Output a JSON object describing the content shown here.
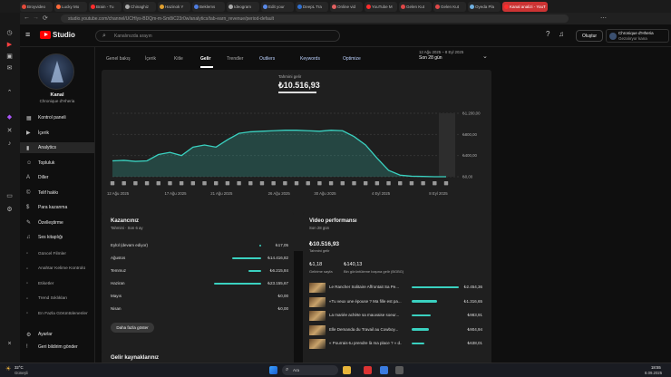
{
  "browser_tabs": [
    {
      "label": "Broyvideo",
      "color": "#e34a3a"
    },
    {
      "label": "Lucky Mo",
      "color": "#ff6a3a"
    },
    {
      "label": "Brain - Tu",
      "color": "#ff2d2d"
    },
    {
      "label": "Chinaghiz",
      "color": "#aaaaaa"
    },
    {
      "label": "Hazinok Y",
      "color": "#e0a030"
    },
    {
      "label": "Beklems",
      "color": "#4f7de0"
    },
    {
      "label": "Ideogram",
      "color": "#aaaaaa"
    },
    {
      "label": "Edit your",
      "color": "#5a8ae8"
    },
    {
      "label": "DeepL Tra",
      "color": "#3070d0"
    },
    {
      "label": "Online vid",
      "color": "#e06060"
    },
    {
      "label": "YouTube M",
      "color": "#ff2d2d"
    },
    {
      "label": "Gelen Kut",
      "color": "#e04848"
    },
    {
      "label": "Gelen Kut",
      "color": "#e04848"
    },
    {
      "label": "Oyeda Pla",
      "color": "#70b0e0"
    },
    {
      "label": "Kanal analizi - YouT",
      "color": "#ff2d2d"
    }
  ],
  "url": "studio.youtube.com/channel/UCHlys-BDQm-m-Sm8iC23r0w/analytics/tab-earn_revenue/period-default",
  "header": {
    "logo_text": "Studio",
    "search_placeholder": "Kanalınızda arayın",
    "create_label": "Oluştur",
    "channel_name": "Chronique d'Hheria",
    "channel_sub": "Gezalıryor kana"
  },
  "sidebar": {
    "channel_title": "Kanal",
    "channel_handle": "Chronique d'Hheria",
    "items": [
      {
        "label": "Kontrol paneli",
        "icon": "▦"
      },
      {
        "label": "İçerik",
        "icon": "▶"
      },
      {
        "label": "Analytics",
        "icon": "▮"
      },
      {
        "label": "Topluluk",
        "icon": "☺"
      },
      {
        "label": "Diller",
        "icon": "A"
      },
      {
        "label": "Telif hakkı",
        "icon": "©"
      },
      {
        "label": "Para kazanma",
        "icon": "$"
      },
      {
        "label": "Özelleştirme",
        "icon": "✎"
      },
      {
        "label": "Ses kitaplığı",
        "icon": "♫"
      }
    ],
    "sub_items": [
      {
        "label": "Güncel Filmler",
        "icon": "◦"
      },
      {
        "label": "Anahtar Kelime Kontrolü",
        "icon": "◦"
      },
      {
        "label": "Etiketler",
        "icon": "◦"
      },
      {
        "label": "Trend Sıklıkları",
        "icon": "◦"
      },
      {
        "label": "En Fazla Görüntülenenler",
        "icon": "◦"
      }
    ],
    "footer": [
      {
        "label": "Ayarlar",
        "icon": "⚙"
      },
      {
        "label": "Geri bildirim gönder",
        "icon": "!"
      }
    ]
  },
  "analytics_tabs": [
    {
      "label": "Genel bakış",
      "active": false
    },
    {
      "label": "İçerik",
      "active": false
    },
    {
      "label": "Kitle",
      "active": false
    },
    {
      "label": "Gelir",
      "active": true
    },
    {
      "label": "Trendler",
      "active": false
    },
    {
      "label": "Outliers",
      "active": false
    },
    {
      "label": "Keywords",
      "active": false
    },
    {
      "label": "Optimize",
      "active": false
    }
  ],
  "period": {
    "range": "12 Ağu 2025 – 8 Eyl 2025",
    "label": "Son 28 gün"
  },
  "revenue_chart": {
    "metric_label": "Tahmini gelir",
    "metric_value": "₺10.516,93",
    "more_button": "Daha fazla göster"
  },
  "chart_data": {
    "type": "area",
    "x_ticks": [
      "12 Ağu 2025",
      "17 Ağu 2025",
      "21 Ağu 2025",
      "26 Ağu 2025",
      "30 Ağu 2025",
      "4 Eyl 2025",
      "8 Eyl 2025"
    ],
    "y_ticks": [
      "₺1.200,00",
      "₺800,00",
      "₺400,00",
      "₺0,00"
    ],
    "ylim": [
      0,
      1200
    ],
    "values": [
      300,
      310,
      290,
      300,
      420,
      460,
      400,
      560,
      600,
      560,
      700,
      820,
      850,
      860,
      870,
      880,
      880,
      870,
      860,
      880,
      870,
      760,
      600,
      350,
      120,
      30,
      10,
      5,
      0,
      0
    ],
    "color": "#3ad1c0"
  },
  "earnings": {
    "title": "Kazancınız",
    "subtitle": "Tahmini · Son 6 ay",
    "rows": [
      {
        "month": "Eylül (devam ediyor)",
        "value": "₺17,05",
        "fraction": 0.02
      },
      {
        "month": "Ağustos",
        "value": "₺14.416,82",
        "fraction": 0.62
      },
      {
        "month": "Temmuz",
        "value": "₺6.215,84",
        "fraction": 0.27
      },
      {
        "month": "Haziran",
        "value": "₺23.155,67",
        "fraction": 1.0
      },
      {
        "month": "Mayıs",
        "value": "₺0,00",
        "fraction": 0
      },
      {
        "month": "Nisan",
        "value": "₺0,00",
        "fraction": 0
      }
    ],
    "more_button": "Daha fazla göster"
  },
  "video_performance": {
    "title": "Video performansı",
    "subtitle": "Son 28 gün",
    "total_value": "₺10.516,93",
    "total_label": "Tahmini gelir",
    "rpm_value": "₺1,18",
    "rpm_label": "Gelirime sayfa",
    "cpm_value": "₺140,13",
    "cpm_label": "Bin görüntüleme başına gelir (BGBG)",
    "videos": [
      {
        "title": "Le Rancher Solitaire Affrontait Sa Pe...",
        "value": "₺2.454,36",
        "fraction": 1.0
      },
      {
        "title": "«Tu veux une épouse ? Ma fille est pa...",
        "value": "₺1.316,65",
        "fraction": 0.54
      },
      {
        "title": "La mariée achète sa mauvaise soeur...",
        "value": "₺983,91",
        "fraction": 0.4
      },
      {
        "title": "Elle Demanda du Travail au Cowboy...",
        "value": "₺904,94",
        "fraction": 0.37
      },
      {
        "title": "« Pourrais-tu prendre là ma place ? » d...",
        "value": "₺638,01",
        "fraction": 0.26
      }
    ]
  },
  "traffic": {
    "title": "Gelir kaynaklarınız"
  },
  "taskbar": {
    "weather_temp": "32°C",
    "weather_desc": "Güneşli",
    "search_label": "Ara",
    "time": "18:55",
    "date": "8.09.2025"
  }
}
